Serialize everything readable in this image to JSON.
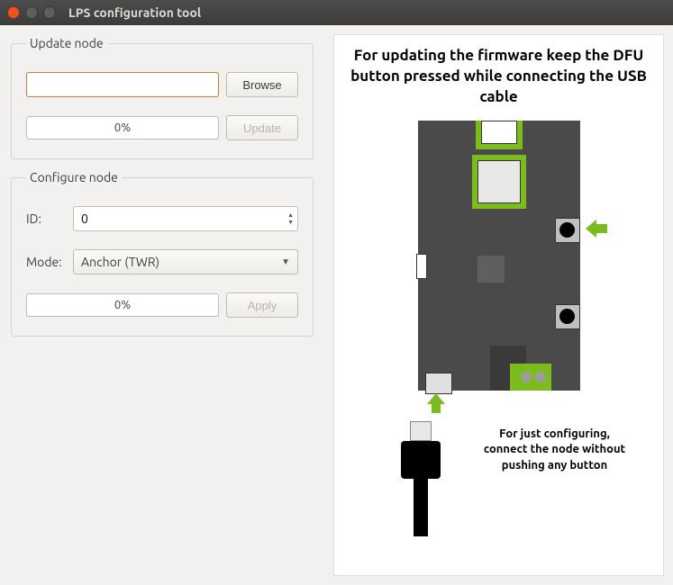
{
  "window": {
    "title": "LPS configuration tool"
  },
  "update_node": {
    "legend": "Update node",
    "file_value": "",
    "browse_label": "Browse",
    "progress_text": "0%",
    "update_label": "Update"
  },
  "configure_node": {
    "legend": "Configure node",
    "id_label": "ID:",
    "id_value": "0",
    "mode_label": "Mode:",
    "mode_value": "Anchor (TWR)",
    "progress_text": "0%",
    "apply_label": "Apply"
  },
  "instructions": {
    "top_text": "For updating the firmware keep the DFU button pressed while connecting the USB cable",
    "bottom_text": "For just configuring, connect the node without pushing any button"
  }
}
